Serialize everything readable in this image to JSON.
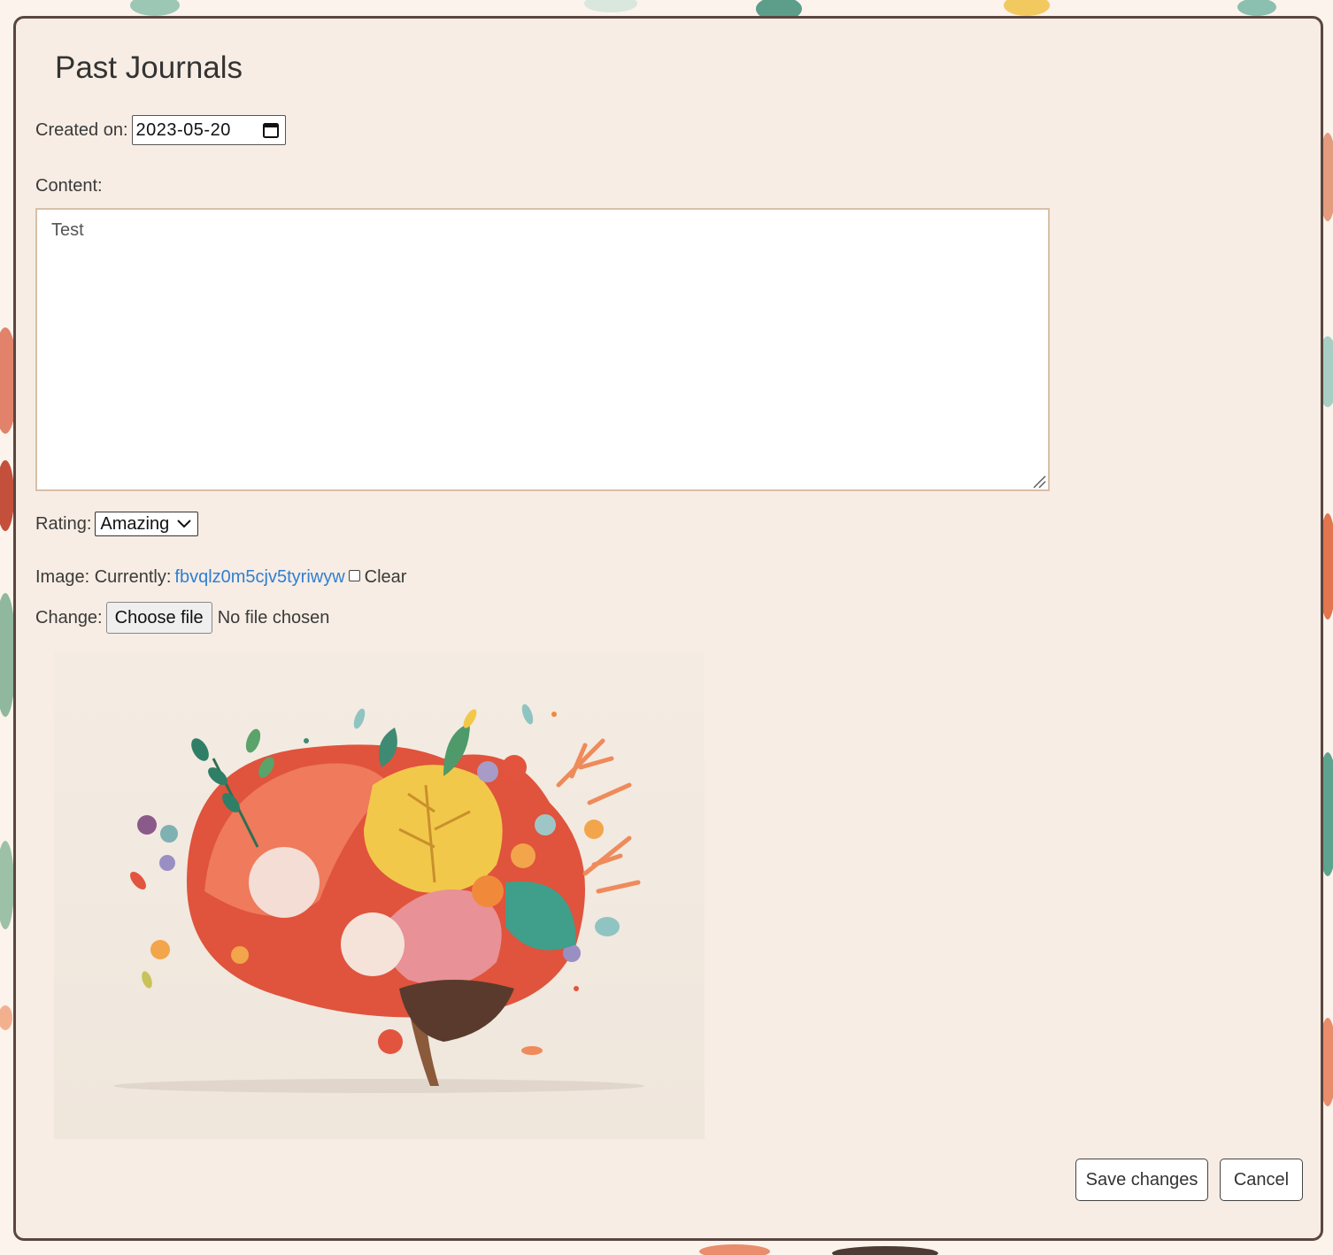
{
  "modal": {
    "title": "Past Journals"
  },
  "form": {
    "created_label": "Created on:",
    "created_value": "2023-05-20",
    "content_label": "Content:",
    "content_value": "Test",
    "rating_label": "Rating:",
    "rating_value": "Amazing",
    "image_label": "Image: Currently:",
    "image_filename": "fbvqlz0m5cjv5tyriwyw",
    "clear_label": "Clear",
    "change_label": "Change:",
    "choose_file_label": "Choose file",
    "file_status": "No file chosen"
  },
  "actions": {
    "save_label": "Save changes",
    "cancel_label": "Cancel"
  },
  "icons": {
    "date": "calendar-icon",
    "select": "chevron-down-icon",
    "resize": "resize-grip-icon"
  },
  "colors": {
    "modal_bg": "#f7ede4",
    "modal_border": "#5a4640",
    "link": "#2f7fd3",
    "textarea_border": "#d8bfa8"
  }
}
